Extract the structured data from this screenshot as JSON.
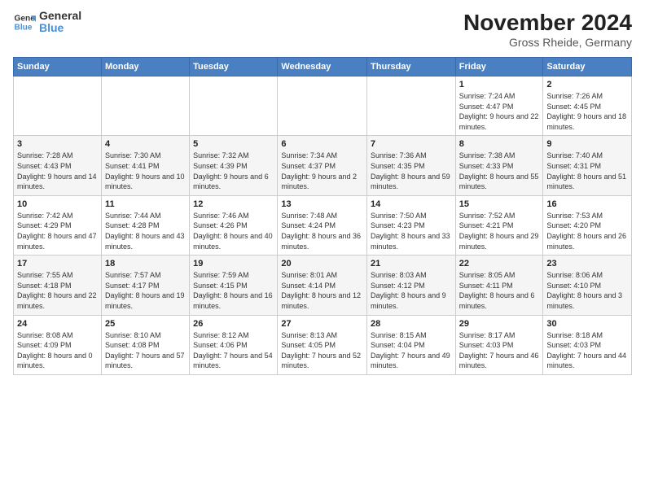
{
  "header": {
    "logo_line1": "General",
    "logo_line2": "Blue",
    "title": "November 2024",
    "subtitle": "Gross Rheide, Germany"
  },
  "calendar": {
    "days_of_week": [
      "Sunday",
      "Monday",
      "Tuesday",
      "Wednesday",
      "Thursday",
      "Friday",
      "Saturday"
    ],
    "weeks": [
      [
        {
          "day": "",
          "info": ""
        },
        {
          "day": "",
          "info": ""
        },
        {
          "day": "",
          "info": ""
        },
        {
          "day": "",
          "info": ""
        },
        {
          "day": "",
          "info": ""
        },
        {
          "day": "1",
          "info": "Sunrise: 7:24 AM\nSunset: 4:47 PM\nDaylight: 9 hours and 22 minutes."
        },
        {
          "day": "2",
          "info": "Sunrise: 7:26 AM\nSunset: 4:45 PM\nDaylight: 9 hours and 18 minutes."
        }
      ],
      [
        {
          "day": "3",
          "info": "Sunrise: 7:28 AM\nSunset: 4:43 PM\nDaylight: 9 hours and 14 minutes."
        },
        {
          "day": "4",
          "info": "Sunrise: 7:30 AM\nSunset: 4:41 PM\nDaylight: 9 hours and 10 minutes."
        },
        {
          "day": "5",
          "info": "Sunrise: 7:32 AM\nSunset: 4:39 PM\nDaylight: 9 hours and 6 minutes."
        },
        {
          "day": "6",
          "info": "Sunrise: 7:34 AM\nSunset: 4:37 PM\nDaylight: 9 hours and 2 minutes."
        },
        {
          "day": "7",
          "info": "Sunrise: 7:36 AM\nSunset: 4:35 PM\nDaylight: 8 hours and 59 minutes."
        },
        {
          "day": "8",
          "info": "Sunrise: 7:38 AM\nSunset: 4:33 PM\nDaylight: 8 hours and 55 minutes."
        },
        {
          "day": "9",
          "info": "Sunrise: 7:40 AM\nSunset: 4:31 PM\nDaylight: 8 hours and 51 minutes."
        }
      ],
      [
        {
          "day": "10",
          "info": "Sunrise: 7:42 AM\nSunset: 4:29 PM\nDaylight: 8 hours and 47 minutes."
        },
        {
          "day": "11",
          "info": "Sunrise: 7:44 AM\nSunset: 4:28 PM\nDaylight: 8 hours and 43 minutes."
        },
        {
          "day": "12",
          "info": "Sunrise: 7:46 AM\nSunset: 4:26 PM\nDaylight: 8 hours and 40 minutes."
        },
        {
          "day": "13",
          "info": "Sunrise: 7:48 AM\nSunset: 4:24 PM\nDaylight: 8 hours and 36 minutes."
        },
        {
          "day": "14",
          "info": "Sunrise: 7:50 AM\nSunset: 4:23 PM\nDaylight: 8 hours and 33 minutes."
        },
        {
          "day": "15",
          "info": "Sunrise: 7:52 AM\nSunset: 4:21 PM\nDaylight: 8 hours and 29 minutes."
        },
        {
          "day": "16",
          "info": "Sunrise: 7:53 AM\nSunset: 4:20 PM\nDaylight: 8 hours and 26 minutes."
        }
      ],
      [
        {
          "day": "17",
          "info": "Sunrise: 7:55 AM\nSunset: 4:18 PM\nDaylight: 8 hours and 22 minutes."
        },
        {
          "day": "18",
          "info": "Sunrise: 7:57 AM\nSunset: 4:17 PM\nDaylight: 8 hours and 19 minutes."
        },
        {
          "day": "19",
          "info": "Sunrise: 7:59 AM\nSunset: 4:15 PM\nDaylight: 8 hours and 16 minutes."
        },
        {
          "day": "20",
          "info": "Sunrise: 8:01 AM\nSunset: 4:14 PM\nDaylight: 8 hours and 12 minutes."
        },
        {
          "day": "21",
          "info": "Sunrise: 8:03 AM\nSunset: 4:12 PM\nDaylight: 8 hours and 9 minutes."
        },
        {
          "day": "22",
          "info": "Sunrise: 8:05 AM\nSunset: 4:11 PM\nDaylight: 8 hours and 6 minutes."
        },
        {
          "day": "23",
          "info": "Sunrise: 8:06 AM\nSunset: 4:10 PM\nDaylight: 8 hours and 3 minutes."
        }
      ],
      [
        {
          "day": "24",
          "info": "Sunrise: 8:08 AM\nSunset: 4:09 PM\nDaylight: 8 hours and 0 minutes."
        },
        {
          "day": "25",
          "info": "Sunrise: 8:10 AM\nSunset: 4:08 PM\nDaylight: 7 hours and 57 minutes."
        },
        {
          "day": "26",
          "info": "Sunrise: 8:12 AM\nSunset: 4:06 PM\nDaylight: 7 hours and 54 minutes."
        },
        {
          "day": "27",
          "info": "Sunrise: 8:13 AM\nSunset: 4:05 PM\nDaylight: 7 hours and 52 minutes."
        },
        {
          "day": "28",
          "info": "Sunrise: 8:15 AM\nSunset: 4:04 PM\nDaylight: 7 hours and 49 minutes."
        },
        {
          "day": "29",
          "info": "Sunrise: 8:17 AM\nSunset: 4:03 PM\nDaylight: 7 hours and 46 minutes."
        },
        {
          "day": "30",
          "info": "Sunrise: 8:18 AM\nSunset: 4:03 PM\nDaylight: 7 hours and 44 minutes."
        }
      ]
    ]
  }
}
